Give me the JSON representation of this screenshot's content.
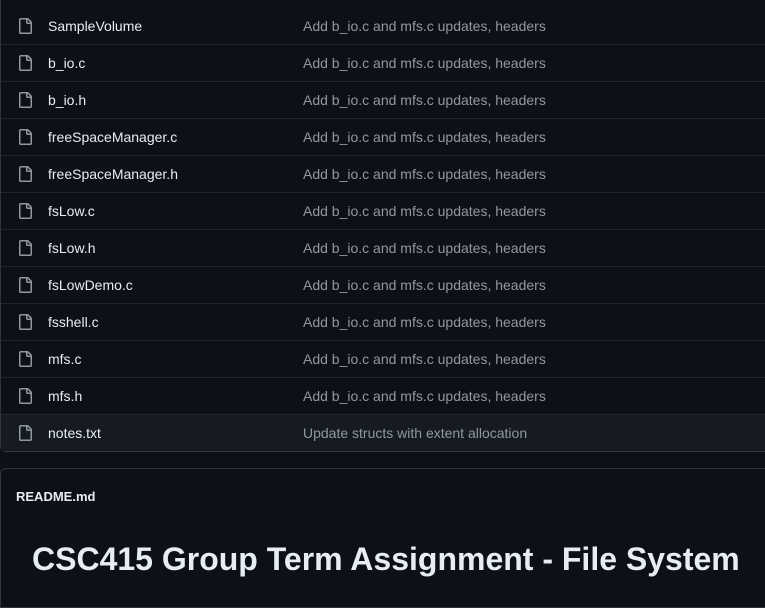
{
  "files": [
    {
      "name": "SampleVolume",
      "message": "Add b_io.c and mfs.c updates, headers",
      "icon": "file-icon"
    },
    {
      "name": "b_io.c",
      "message": "Add b_io.c and mfs.c updates, headers",
      "icon": "file-icon"
    },
    {
      "name": "b_io.h",
      "message": "Add b_io.c and mfs.c updates, headers",
      "icon": "file-icon"
    },
    {
      "name": "freeSpaceManager.c",
      "message": "Add b_io.c and mfs.c updates, headers",
      "icon": "file-icon"
    },
    {
      "name": "freeSpaceManager.h",
      "message": "Add b_io.c and mfs.c updates, headers",
      "icon": "file-icon"
    },
    {
      "name": "fsLow.c",
      "message": "Add b_io.c and mfs.c updates, headers",
      "icon": "file-icon"
    },
    {
      "name": "fsLow.h",
      "message": "Add b_io.c and mfs.c updates, headers",
      "icon": "file-icon"
    },
    {
      "name": "fsLowDemo.c",
      "message": "Add b_io.c and mfs.c updates, headers",
      "icon": "file-icon"
    },
    {
      "name": "fsshell.c",
      "message": "Add b_io.c and mfs.c updates, headers",
      "icon": "file-icon"
    },
    {
      "name": "mfs.c",
      "message": "Add b_io.c and mfs.c updates, headers",
      "icon": "file-icon"
    },
    {
      "name": "mfs.h",
      "message": "Add b_io.c and mfs.c updates, headers",
      "icon": "file-icon"
    },
    {
      "name": "notes.txt",
      "message": "Update structs with extent allocation",
      "icon": "file-icon"
    }
  ],
  "readme": {
    "filename": "README.md",
    "title": "CSC415 Group Term Assignment - File System"
  },
  "colors": {
    "background": "#0d1117",
    "border": "#30363d",
    "text": "#e6edf3",
    "muted": "#9198a1",
    "hover_row": "#161b22"
  }
}
